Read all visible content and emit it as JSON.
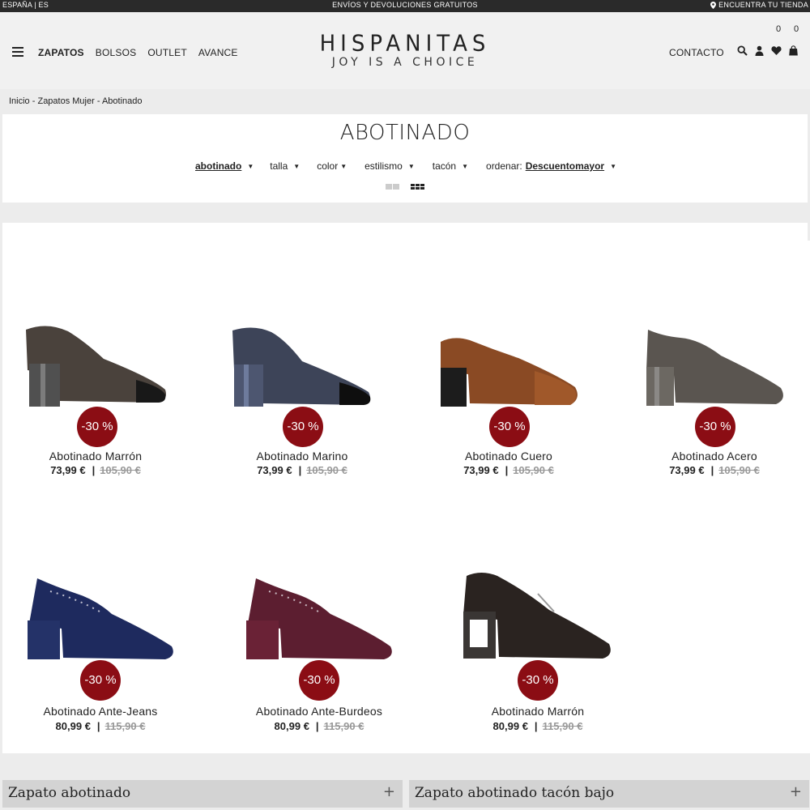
{
  "topbar": {
    "lang": "ESPAÑA | ES",
    "promo": "ENVÍOS Y DEVOLUCIONES GRATUITOS",
    "store": "ENCUENTRA TU TIENDA"
  },
  "header": {
    "nav": [
      "ZAPATOS",
      "BOLSOS",
      "OUTLET",
      "AVANCE"
    ],
    "brand": "HISPANITAS",
    "tagline": "JOY IS A CHOICE",
    "contact": "CONTACTO",
    "wishlist_count": "0",
    "cart_count": "0"
  },
  "breadcrumb": {
    "home": "Inicio",
    "category": "Zapatos Mujer",
    "current": "Abotinado",
    "sep": " - "
  },
  "page": {
    "title": "ABOTINADO",
    "filters": {
      "abotinado": "abotinado",
      "talla": "talla",
      "color": "color",
      "estilismo": "estilismo",
      "tacon": "tacón",
      "ordenar_label": "ordenar:",
      "ordenar_value": "Descuentomayor",
      "arrow": "▼"
    }
  },
  "products": [
    {
      "name": "Abotinado Marrón",
      "price": "73,99 €",
      "old_price": "105,90 €",
      "discount": "-30 %"
    },
    {
      "name": "Abotinado Marino",
      "price": "73,99 €",
      "old_price": "105,90 €",
      "discount": "-30 %"
    },
    {
      "name": "Abotinado Cuero",
      "price": "73,99 €",
      "old_price": "105,90 €",
      "discount": "-30 %"
    },
    {
      "name": "Abotinado Acero",
      "price": "73,99 €",
      "old_price": "105,90 €",
      "discount": "-30 %"
    },
    {
      "name": "Abotinado Ante-Jeans",
      "price": "80,99 €",
      "old_price": "115,90 €",
      "discount": "-30 %"
    },
    {
      "name": "Abotinado Ante-Burdeos",
      "price": "80,99 €",
      "old_price": "115,90 €",
      "discount": "-30 %"
    },
    {
      "name": "Abotinado Marrón",
      "price": "80,99 €",
      "old_price": "115,90 €",
      "discount": "-30 %"
    }
  ],
  "accordions": [
    {
      "label": "Zapato abotinado",
      "icon": "+"
    },
    {
      "label": "Zapato abotinado tacón bajo",
      "icon": "+"
    }
  ],
  "colors": {
    "badge": "#8b0d14",
    "topbar": "#2a2a2a"
  }
}
